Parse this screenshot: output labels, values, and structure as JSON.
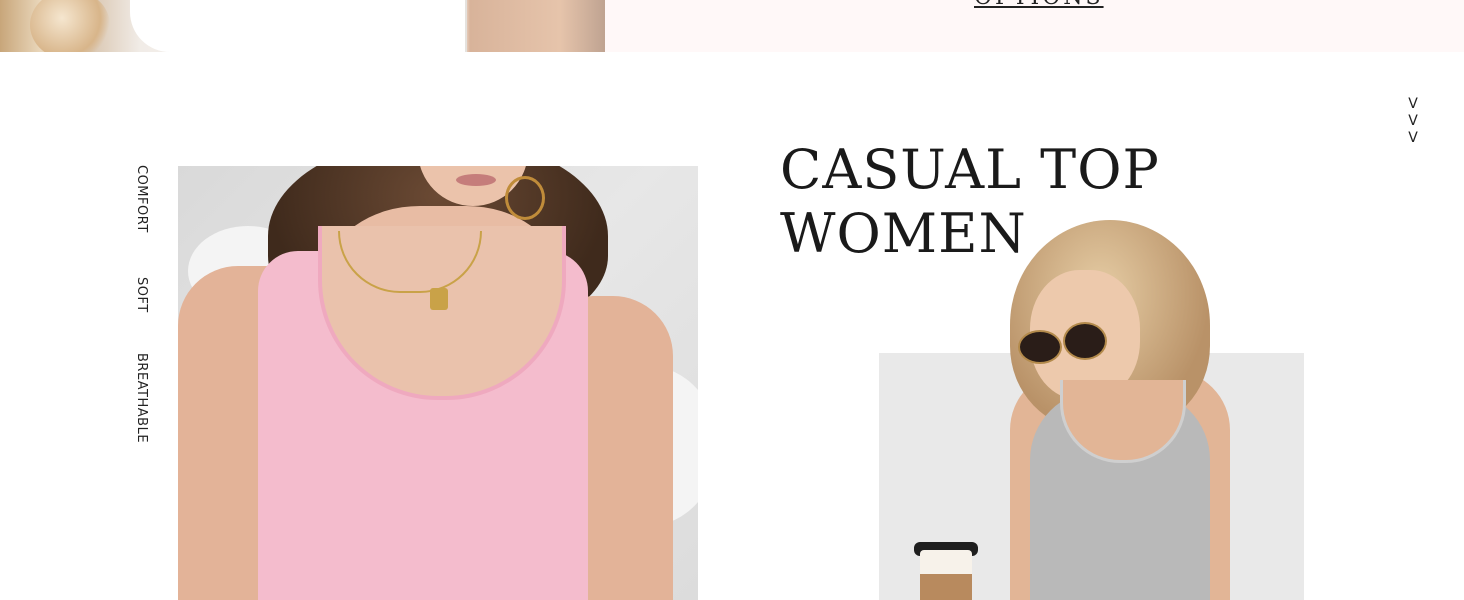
{
  "top_banner": {
    "link_text": "OPTIONS"
  },
  "features": {
    "items": [
      "COMFORT",
      "SOFT",
      "BREATHABLE"
    ]
  },
  "scroll_hint": {
    "glyphs": [
      "V",
      "V",
      "V"
    ]
  },
  "headline": {
    "line1": "CASUAL TOP",
    "line2": "WOMEN"
  },
  "colors": {
    "banner_pink": "#fff8f8",
    "text": "#1a1a1a",
    "pink_tank": "#f4bccd",
    "gray_tank": "#b9b9b9",
    "photo_bg": "#e9e9e9"
  }
}
